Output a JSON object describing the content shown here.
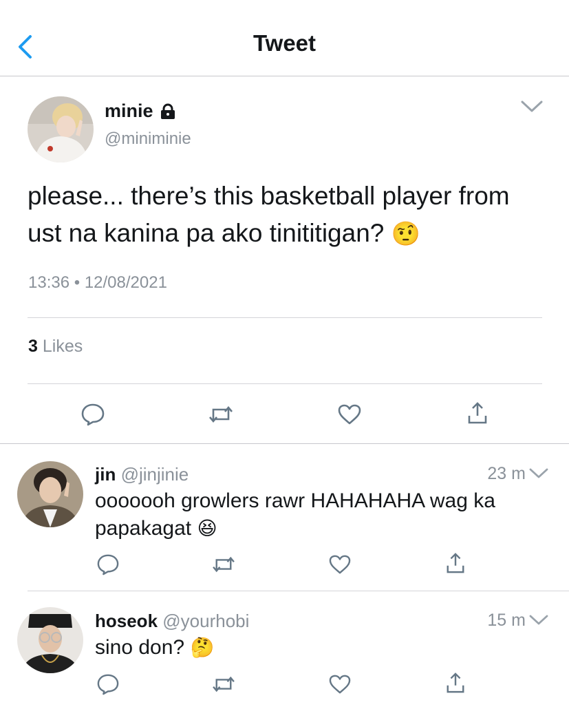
{
  "header": {
    "title": "Tweet",
    "back_icon": "chevron-left-icon"
  },
  "tweet": {
    "name": "minie",
    "handle": "@miniminie",
    "locked_icon": "lock-icon",
    "text": "please... there’s this basketball player from ust na kanina pa ako tinititigan?",
    "emoji": "🤨",
    "time": "13:36",
    "dot": "•",
    "date": "12/08/2021",
    "likes_count": "3",
    "likes_label": "Likes"
  },
  "replies": [
    {
      "name": "jin",
      "handle": "@jinjinie",
      "time": "23 m",
      "text_line1": "ooooooh growlers rawr HAHAHAHA wag ka",
      "text_line2": "papakagat",
      "emoji": "😆"
    },
    {
      "name": "hoseok",
      "handle": "@yourhobi",
      "time": "15 m",
      "text_line1": "sino don?",
      "emoji": "🤔"
    }
  ],
  "actions": [
    "reply-icon",
    "retweet-icon",
    "like-icon",
    "share-icon"
  ],
  "colors": {
    "accent": "#1d9bf0",
    "text": "#14171a",
    "secondary": "#8a9199",
    "icon": "#657786"
  }
}
